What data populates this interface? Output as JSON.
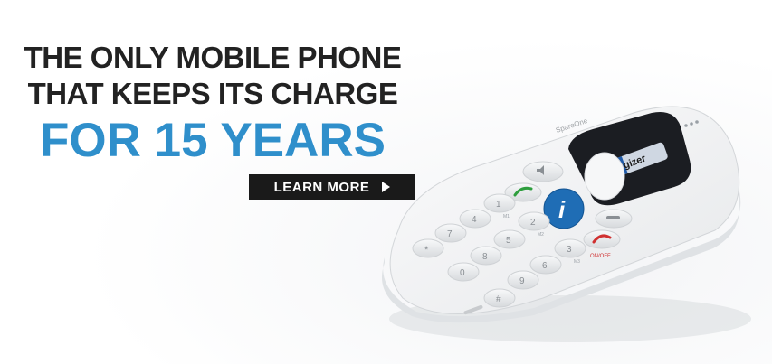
{
  "headline": {
    "line1": "THE ONLY MOBILE PHONE",
    "line2": "THAT KEEPS ITS CHARGE",
    "line3": "FOR 15 YEARS"
  },
  "cta": {
    "label": "LEARN MORE",
    "icon": "play-triangle-icon"
  },
  "phone": {
    "brand_text": "SpareOne",
    "battery_brand": "ergizer",
    "info_key_symbol": "i",
    "end_key_caption": "ON/OFF",
    "keys": [
      "1",
      "2",
      "3",
      "4",
      "5",
      "6",
      "7",
      "8",
      "9",
      "*",
      "0",
      "#"
    ],
    "key_subtext": [
      "M1",
      "M2",
      "M3"
    ],
    "colors": {
      "body": "#f4f5f6",
      "info_key": "#1f6db5",
      "call_icon": "#2e9e3e",
      "end_icon": "#d03030",
      "window": "#1b1d22"
    }
  },
  "colors": {
    "headline_dark": "#222222",
    "headline_accent": "#2f8fcb",
    "cta_background": "#1a1a1a"
  }
}
